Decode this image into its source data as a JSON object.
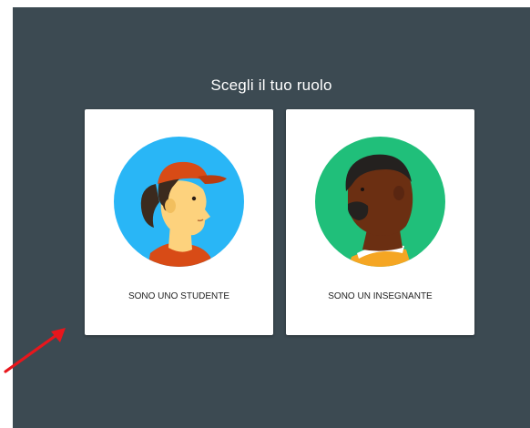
{
  "page": {
    "title": "Scegli il tuo ruolo"
  },
  "roles": [
    {
      "label": "SONO UNO STUDENTE",
      "icon": "student-avatar-icon"
    },
    {
      "label": "SONO UN INSEGNANTE",
      "icon": "teacher-avatar-icon"
    }
  ],
  "colors": {
    "background": "#3c4a52",
    "card": "#ffffff",
    "student_circle": "#29b6f6",
    "teacher_circle": "#20bf7a",
    "cap": "#d84b16",
    "annotation_arrow": "#e8161c"
  }
}
